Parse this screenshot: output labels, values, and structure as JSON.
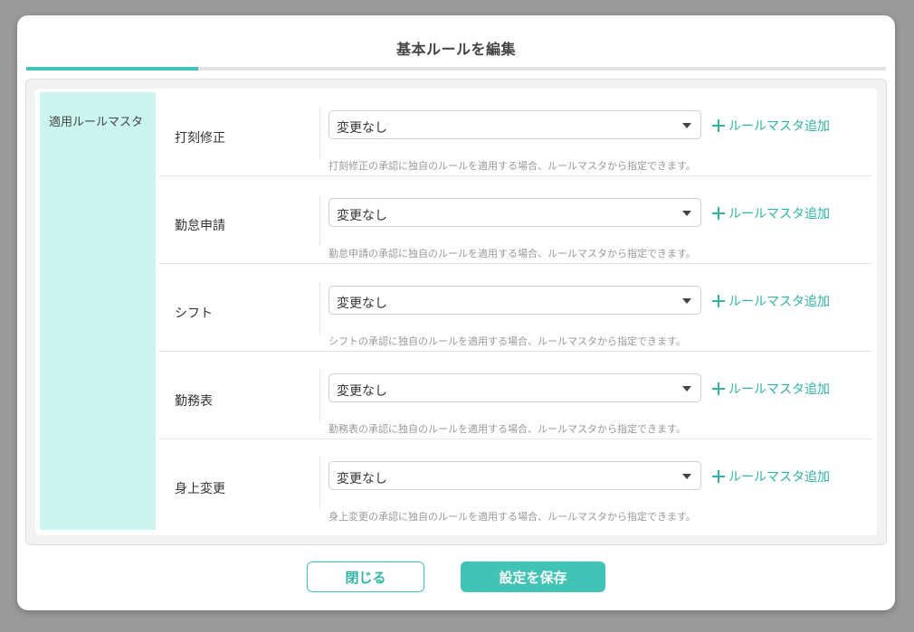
{
  "modal": {
    "title": "基本ルールを編集"
  },
  "side": {
    "label": "適用ルールマスタ"
  },
  "rows": [
    {
      "label": "打刻修正",
      "select_value": "変更なし",
      "add_label": "ルールマスタ追加",
      "help": "打刻修正の承認に独自のルールを適用する場合、ルールマスタから指定できます。"
    },
    {
      "label": "勤怠申請",
      "select_value": "変更なし",
      "add_label": "ルールマスタ追加",
      "help": "勤怠申請の承認に独自のルールを適用する場合、ルールマスタから指定できます。"
    },
    {
      "label": "シフト",
      "select_value": "変更なし",
      "add_label": "ルールマスタ追加",
      "help": "シフトの承認に独自のルールを適用する場合、ルールマスタから指定できます。"
    },
    {
      "label": "勤務表",
      "select_value": "変更なし",
      "add_label": "ルールマスタ追加",
      "help": "勤務表の承認に独自のルールを適用する場合、ルールマスタから指定できます。"
    },
    {
      "label": "身上変更",
      "select_value": "変更なし",
      "add_label": "ルールマスタ追加",
      "help": "身上変更の承認に独自のルールを適用する場合、ルールマスタから指定できます。"
    }
  ],
  "footer": {
    "close_label": "閉じる",
    "save_label": "設定を保存"
  },
  "colors": {
    "accent": "#41c4b5",
    "side_bg": "#ccf5f0"
  },
  "icons": {
    "add": "plus-icon",
    "dropdown": "caret-down-icon"
  }
}
